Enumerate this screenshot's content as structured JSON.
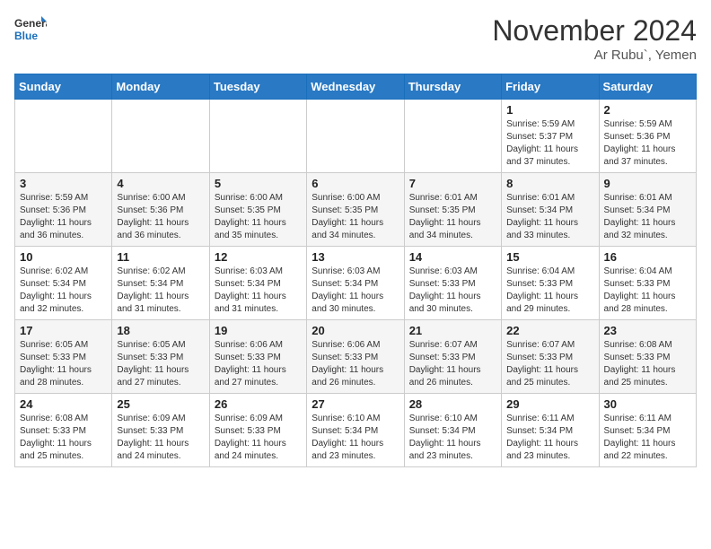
{
  "header": {
    "logo_general": "General",
    "logo_blue": "Blue",
    "month_title": "November 2024",
    "location": "Ar Rubu`, Yemen"
  },
  "weekdays": [
    "Sunday",
    "Monday",
    "Tuesday",
    "Wednesday",
    "Thursday",
    "Friday",
    "Saturday"
  ],
  "weeks": [
    [
      {
        "day": "",
        "sunrise": "",
        "sunset": "",
        "daylight": ""
      },
      {
        "day": "",
        "sunrise": "",
        "sunset": "",
        "daylight": ""
      },
      {
        "day": "",
        "sunrise": "",
        "sunset": "",
        "daylight": ""
      },
      {
        "day": "",
        "sunrise": "",
        "sunset": "",
        "daylight": ""
      },
      {
        "day": "",
        "sunrise": "",
        "sunset": "",
        "daylight": ""
      },
      {
        "day": "1",
        "sunrise": "Sunrise: 5:59 AM",
        "sunset": "Sunset: 5:37 PM",
        "daylight": "Daylight: 11 hours and 37 minutes."
      },
      {
        "day": "2",
        "sunrise": "Sunrise: 5:59 AM",
        "sunset": "Sunset: 5:36 PM",
        "daylight": "Daylight: 11 hours and 37 minutes."
      }
    ],
    [
      {
        "day": "3",
        "sunrise": "Sunrise: 5:59 AM",
        "sunset": "Sunset: 5:36 PM",
        "daylight": "Daylight: 11 hours and 36 minutes."
      },
      {
        "day": "4",
        "sunrise": "Sunrise: 6:00 AM",
        "sunset": "Sunset: 5:36 PM",
        "daylight": "Daylight: 11 hours and 36 minutes."
      },
      {
        "day": "5",
        "sunrise": "Sunrise: 6:00 AM",
        "sunset": "Sunset: 5:35 PM",
        "daylight": "Daylight: 11 hours and 35 minutes."
      },
      {
        "day": "6",
        "sunrise": "Sunrise: 6:00 AM",
        "sunset": "Sunset: 5:35 PM",
        "daylight": "Daylight: 11 hours and 34 minutes."
      },
      {
        "day": "7",
        "sunrise": "Sunrise: 6:01 AM",
        "sunset": "Sunset: 5:35 PM",
        "daylight": "Daylight: 11 hours and 34 minutes."
      },
      {
        "day": "8",
        "sunrise": "Sunrise: 6:01 AM",
        "sunset": "Sunset: 5:34 PM",
        "daylight": "Daylight: 11 hours and 33 minutes."
      },
      {
        "day": "9",
        "sunrise": "Sunrise: 6:01 AM",
        "sunset": "Sunset: 5:34 PM",
        "daylight": "Daylight: 11 hours and 32 minutes."
      }
    ],
    [
      {
        "day": "10",
        "sunrise": "Sunrise: 6:02 AM",
        "sunset": "Sunset: 5:34 PM",
        "daylight": "Daylight: 11 hours and 32 minutes."
      },
      {
        "day": "11",
        "sunrise": "Sunrise: 6:02 AM",
        "sunset": "Sunset: 5:34 PM",
        "daylight": "Daylight: 11 hours and 31 minutes."
      },
      {
        "day": "12",
        "sunrise": "Sunrise: 6:03 AM",
        "sunset": "Sunset: 5:34 PM",
        "daylight": "Daylight: 11 hours and 31 minutes."
      },
      {
        "day": "13",
        "sunrise": "Sunrise: 6:03 AM",
        "sunset": "Sunset: 5:34 PM",
        "daylight": "Daylight: 11 hours and 30 minutes."
      },
      {
        "day": "14",
        "sunrise": "Sunrise: 6:03 AM",
        "sunset": "Sunset: 5:33 PM",
        "daylight": "Daylight: 11 hours and 30 minutes."
      },
      {
        "day": "15",
        "sunrise": "Sunrise: 6:04 AM",
        "sunset": "Sunset: 5:33 PM",
        "daylight": "Daylight: 11 hours and 29 minutes."
      },
      {
        "day": "16",
        "sunrise": "Sunrise: 6:04 AM",
        "sunset": "Sunset: 5:33 PM",
        "daylight": "Daylight: 11 hours and 28 minutes."
      }
    ],
    [
      {
        "day": "17",
        "sunrise": "Sunrise: 6:05 AM",
        "sunset": "Sunset: 5:33 PM",
        "daylight": "Daylight: 11 hours and 28 minutes."
      },
      {
        "day": "18",
        "sunrise": "Sunrise: 6:05 AM",
        "sunset": "Sunset: 5:33 PM",
        "daylight": "Daylight: 11 hours and 27 minutes."
      },
      {
        "day": "19",
        "sunrise": "Sunrise: 6:06 AM",
        "sunset": "Sunset: 5:33 PM",
        "daylight": "Daylight: 11 hours and 27 minutes."
      },
      {
        "day": "20",
        "sunrise": "Sunrise: 6:06 AM",
        "sunset": "Sunset: 5:33 PM",
        "daylight": "Daylight: 11 hours and 26 minutes."
      },
      {
        "day": "21",
        "sunrise": "Sunrise: 6:07 AM",
        "sunset": "Sunset: 5:33 PM",
        "daylight": "Daylight: 11 hours and 26 minutes."
      },
      {
        "day": "22",
        "sunrise": "Sunrise: 6:07 AM",
        "sunset": "Sunset: 5:33 PM",
        "daylight": "Daylight: 11 hours and 25 minutes."
      },
      {
        "day": "23",
        "sunrise": "Sunrise: 6:08 AM",
        "sunset": "Sunset: 5:33 PM",
        "daylight": "Daylight: 11 hours and 25 minutes."
      }
    ],
    [
      {
        "day": "24",
        "sunrise": "Sunrise: 6:08 AM",
        "sunset": "Sunset: 5:33 PM",
        "daylight": "Daylight: 11 hours and 25 minutes."
      },
      {
        "day": "25",
        "sunrise": "Sunrise: 6:09 AM",
        "sunset": "Sunset: 5:33 PM",
        "daylight": "Daylight: 11 hours and 24 minutes."
      },
      {
        "day": "26",
        "sunrise": "Sunrise: 6:09 AM",
        "sunset": "Sunset: 5:33 PM",
        "daylight": "Daylight: 11 hours and 24 minutes."
      },
      {
        "day": "27",
        "sunrise": "Sunrise: 6:10 AM",
        "sunset": "Sunset: 5:34 PM",
        "daylight": "Daylight: 11 hours and 23 minutes."
      },
      {
        "day": "28",
        "sunrise": "Sunrise: 6:10 AM",
        "sunset": "Sunset: 5:34 PM",
        "daylight": "Daylight: 11 hours and 23 minutes."
      },
      {
        "day": "29",
        "sunrise": "Sunrise: 6:11 AM",
        "sunset": "Sunset: 5:34 PM",
        "daylight": "Daylight: 11 hours and 23 minutes."
      },
      {
        "day": "30",
        "sunrise": "Sunrise: 6:11 AM",
        "sunset": "Sunset: 5:34 PM",
        "daylight": "Daylight: 11 hours and 22 minutes."
      }
    ]
  ]
}
